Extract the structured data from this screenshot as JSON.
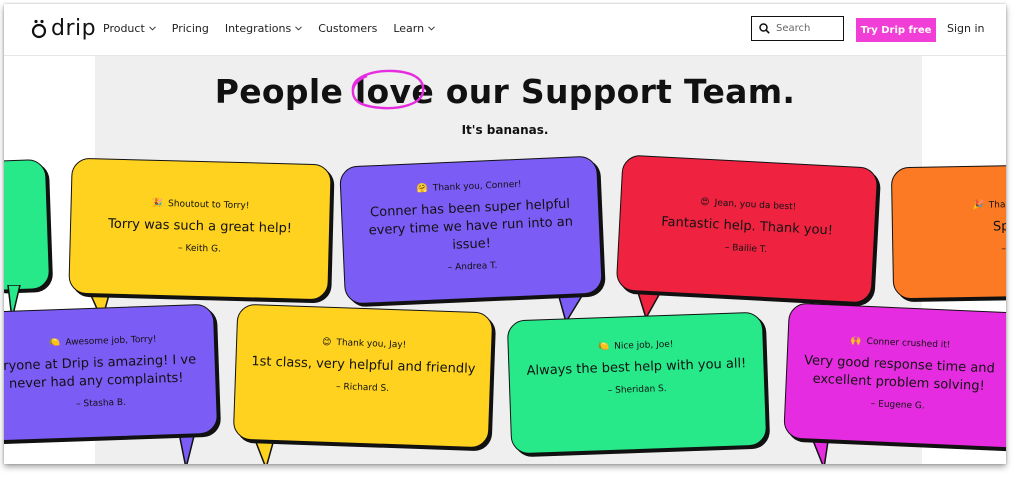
{
  "nav": {
    "logo_text": "drip",
    "items": [
      {
        "label": "Product",
        "dropdown": true
      },
      {
        "label": "Pricing",
        "dropdown": false
      },
      {
        "label": "Integrations",
        "dropdown": true
      },
      {
        "label": "Customers",
        "dropdown": false
      },
      {
        "label": "Learn",
        "dropdown": true
      }
    ],
    "search_placeholder": "Search",
    "cta_label": "Try Drip free",
    "signin_label": "Sign in"
  },
  "hero": {
    "title_before": "People ",
    "title_highlight": "love",
    "title_after": " our Support Team.",
    "subtitle": "It's bananas."
  },
  "colors": {
    "brand_pink": "#f13ed6",
    "yellow": "#ffd21f",
    "purple": "#7b5cf5",
    "red": "#ef2340",
    "orange": "#fd7a25",
    "green": "#27e98a",
    "magenta": "#e62ce0"
  },
  "testimonials": [
    {
      "head": "Shoutout to Torry!",
      "quote": "Torry was such a great help!",
      "author": "– Keith G."
    },
    {
      "head": "Thank you, Conner!",
      "quote": "Conner has been super helpful every time we have run into an issue!",
      "author": "– Andrea T."
    },
    {
      "head": "Jean, you da best!",
      "quote": "Fantastic help. Thank you!",
      "author": "– Bailie T."
    },
    {
      "head": "Tha",
      "quote": "Sp",
      "author": "–"
    },
    {
      "head": "Awesome job, Torry!",
      "quote": "eryone at Drip is amazing! I ve never had any complaints!",
      "author": "– Stasha B."
    },
    {
      "head": "Thank you, Jay!",
      "quote": "1st class, very helpful and friendly",
      "author": "– Richard S."
    },
    {
      "head": "Nice job, Joe!",
      "quote": "Always the best help with you all!",
      "author": "– Sheridan S."
    },
    {
      "head": "Conner crushed it!",
      "quote": "Very good response time and excellent problem solving!",
      "author": "– Eugene G."
    }
  ]
}
